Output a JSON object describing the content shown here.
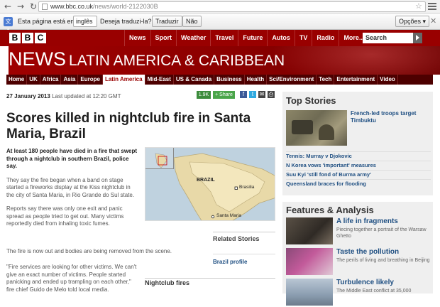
{
  "browser": {
    "url_host": "www.bbc.co.uk",
    "url_path": "/news/world-2122030B"
  },
  "translate_bar": {
    "prefix": "Esta página está em",
    "language": "inglês",
    "question": "Deseja traduzi-la?",
    "translate_button": "Traduzir",
    "no_button": "Não",
    "options_button": "Opções"
  },
  "bbc": {
    "logo_letters": [
      "B",
      "B",
      "C"
    ],
    "topnav": [
      "News",
      "Sport",
      "Weather",
      "Travel",
      "Future",
      "Autos",
      "TV",
      "Radio",
      "More..."
    ],
    "search_placeholder": "Search"
  },
  "banner": {
    "news": "NEWS",
    "section": "LATIN AMERICA & CARIBBEAN"
  },
  "subnav": {
    "items": [
      "Home",
      "UK",
      "Africa",
      "Asia",
      "Europe",
      "Latin America",
      "Mid-East",
      "US & Canada",
      "Business",
      "Health",
      "Sci/Environment",
      "Tech",
      "Entertainment",
      "Video"
    ],
    "active": "Latin America"
  },
  "article": {
    "date": "27 January 2013",
    "updated": "Last updated at 12:20 GMT",
    "share_count": "1.9K",
    "share_label": "Share",
    "headline": "Scores killed in nightclub fire in Santa Maria, Brazil",
    "lead": "At least 180 people have died in a fire that swept through a nightclub in southern Brazil, police say.",
    "paragraphs": [
      "They say the fire began when a band on stage started a fireworks display at the Kiss nightclub in the city of Santa Maria, in Rio Grande do Sul state.",
      "Reports say there was only one exit and panic spread as people tried to get out. Many victims reportedly died from inhaling toxic fumes.",
      "The fire is now out and bodies are being removed from the scene.",
      "\"Fire services are looking for other victims. We can't give an exact number of victims. People started panicking and ended up trampling on each other,\" fire chief Guido de Melo told local media."
    ],
    "map_labels": {
      "country": "BRAZIL",
      "capital": "Brasilia",
      "city": "Santa Maria"
    },
    "related_title": "Related Stories",
    "related_links": [
      "Brazil profile"
    ],
    "nightclub_caption": "Nightclub fires"
  },
  "sidebar": {
    "top_stories_title": "Top Stories",
    "lead_story": "French-led troops target Timbuktu",
    "stories": [
      "Tennis: Murray v Djokovic",
      "N Korea vows 'important' measures",
      "Suu Kyi 'still fond of Burma army'",
      "Queensland braces for flooding"
    ],
    "features_title": "Features & Analysis",
    "features": [
      {
        "title": "A life in fragments",
        "desc": "Piecing together a portrait of the Warsaw Ghetto"
      },
      {
        "title": "Taste the pollution",
        "desc": "The perils of living and breathing in Beijing"
      },
      {
        "title": "Turbulence likely",
        "desc": "The Middle East conflict at 35,000"
      }
    ]
  },
  "colors": {
    "bbc_red": "#990000",
    "link_blue": "#1f4f82"
  }
}
